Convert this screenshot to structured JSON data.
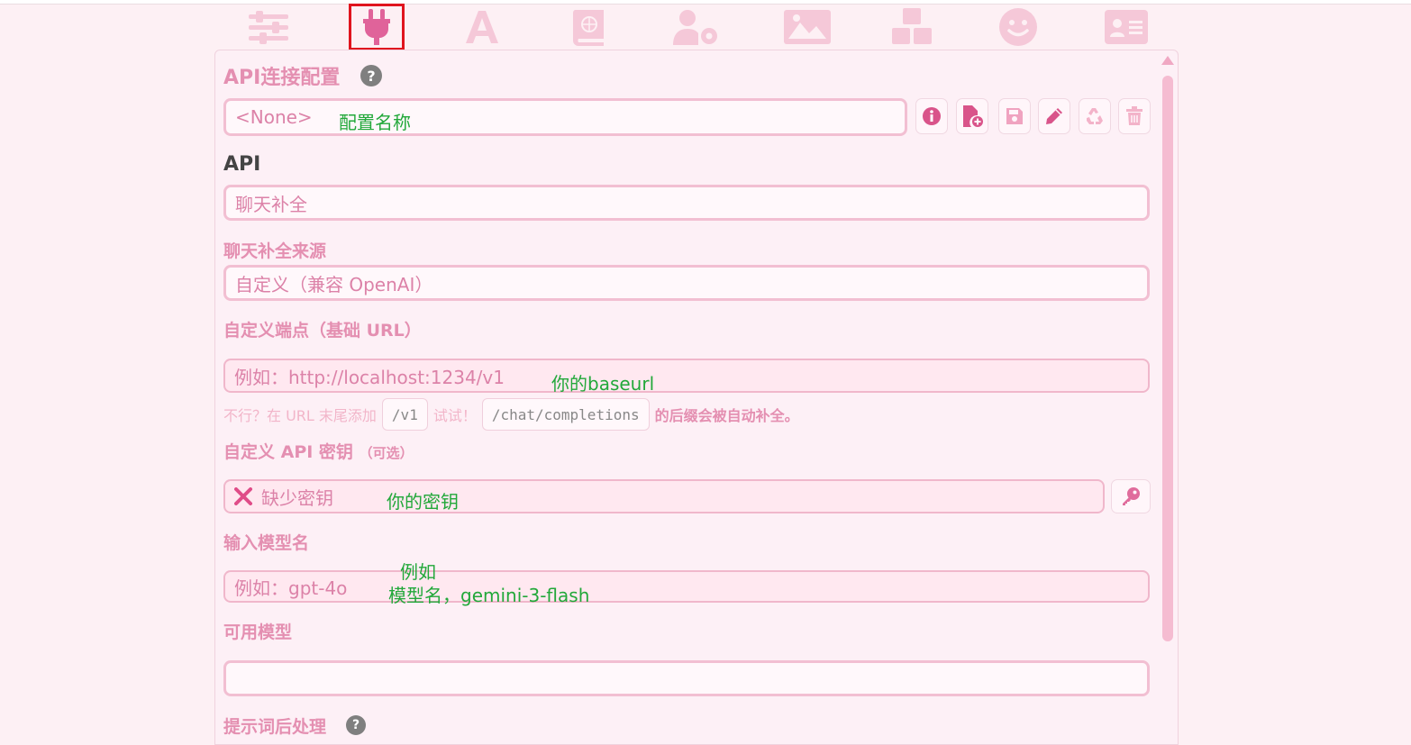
{
  "tabs": [
    {
      "id": "sliders",
      "icon": "sliders-icon"
    },
    {
      "id": "plug",
      "icon": "plug-icon",
      "active": true
    },
    {
      "id": "font",
      "icon": "font-a-icon"
    },
    {
      "id": "book",
      "icon": "world-book-icon"
    },
    {
      "id": "user-gear",
      "icon": "user-gear-icon"
    },
    {
      "id": "image",
      "icon": "landscape-image-icon"
    },
    {
      "id": "cubes",
      "icon": "cubes-icon"
    },
    {
      "id": "smile",
      "icon": "smile-icon"
    },
    {
      "id": "id-card",
      "icon": "id-card-icon"
    }
  ],
  "panel": {
    "title": "API连接配置",
    "help": "?",
    "profile": {
      "value": "<None>",
      "annotation": "配置名称",
      "actions": [
        "info-icon",
        "new-file-icon",
        "save-icon",
        "pencil-icon",
        "recycle-icon",
        "trash-icon"
      ]
    },
    "api": {
      "heading": "API",
      "value": "聊天补全"
    },
    "source": {
      "label": "聊天补全来源",
      "value": "自定义（兼容 OpenAI）"
    },
    "endpoint": {
      "label": "自定义端点（基础 URL）",
      "placeholder": "例如：http://localhost:1234/v1",
      "annotation": "你的baseurl",
      "hint": {
        "prefix": "不行？在 URL 末尾添加",
        "code1": "/v1",
        "mid": "试试！",
        "code2": "/chat/completions",
        "suffix": "的后缀会被自动补全。"
      }
    },
    "api_key": {
      "label": "自定义 API 密钥",
      "optional": "（可选）",
      "status_icon": "cross-icon",
      "value": "缺少密钥",
      "annotation": "你的密钥",
      "key_button_icon": "key-icon"
    },
    "model": {
      "label": "输入模型名",
      "placeholder": "例如：gpt-4o",
      "annotation_line1": "例如",
      "annotation_line2": "模型名，gemini-3-flash"
    },
    "available_models": {
      "label": "可用模型",
      "value": ""
    },
    "postprocess": {
      "label": "提示词后处理",
      "help": "?"
    }
  },
  "colors": {
    "accent": "#e48fb1",
    "active_tab_icon": "#e0639a",
    "active_tab_outline": "#e0141e",
    "annotation_green": "#22a83a"
  }
}
